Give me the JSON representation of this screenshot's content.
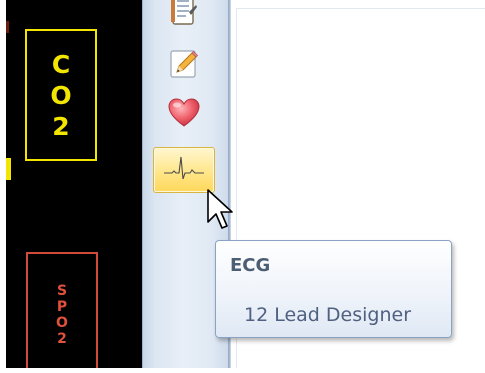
{
  "monitor": {
    "co2_label": [
      "C",
      "O",
      "2"
    ],
    "spo2_label": [
      "S",
      "P",
      "O",
      "2"
    ],
    "co2_color": "#f2e600",
    "spo2_color": "#e0513c"
  },
  "toolbar": {
    "buttons": [
      {
        "icon": "notepad-icon"
      },
      {
        "icon": "pencil-edit-icon"
      },
      {
        "icon": "heart-icon"
      },
      {
        "icon": "ecg-waveform-icon",
        "state": "hovered"
      }
    ]
  },
  "tooltip": {
    "title": "ECG",
    "description": "12 Lead Designer"
  }
}
